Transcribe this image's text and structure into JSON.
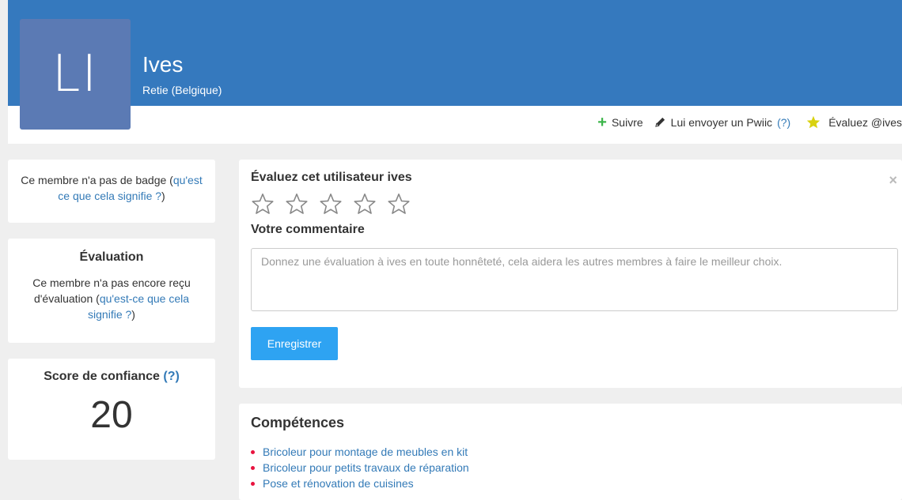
{
  "profile": {
    "initials": "LI",
    "name": "Ives",
    "location": "Retie (Belgique)",
    "banner_color": "#3579be",
    "avatar_color": "#5b7ab4"
  },
  "actions": {
    "follow": "Suivre",
    "send_pwiic": "Lui envoyer un Pwiic",
    "help_mark": "(?)",
    "rate": "Évaluez @ives"
  },
  "badge": {
    "text": "Ce membre n'a pas de badge (",
    "link": "qu'est ce que cela signifie ?",
    "close": ")"
  },
  "evaluation": {
    "title": "Évaluation",
    "text": "Ce membre n'a pas encore reçu d'évaluation (",
    "link": "qu'est-ce que cela signifie ?",
    "close": ")"
  },
  "trust": {
    "title": "Score de confiance",
    "help": "(?)",
    "score": "20"
  },
  "rate_form": {
    "title": "Évaluez cet utilisateur ives",
    "close_icon": "×",
    "stars_total": 5,
    "stars_filled": 0,
    "comment_label": "Votre commentaire",
    "placeholder": "Donnez une évaluation à ives en toute honnêteté, cela aidera les autres membres à faire le meilleur choix.",
    "value": "",
    "save_label": "Enregistrer",
    "button_color": "#2ea3f2"
  },
  "skills": {
    "title": "Compétences",
    "items": [
      "Bricoleur pour montage de meubles en kit",
      "Bricoleur pour petits travaux de réparation",
      "Pose et rénovation de cuisines"
    ],
    "bullet_color": "#e8133f"
  }
}
